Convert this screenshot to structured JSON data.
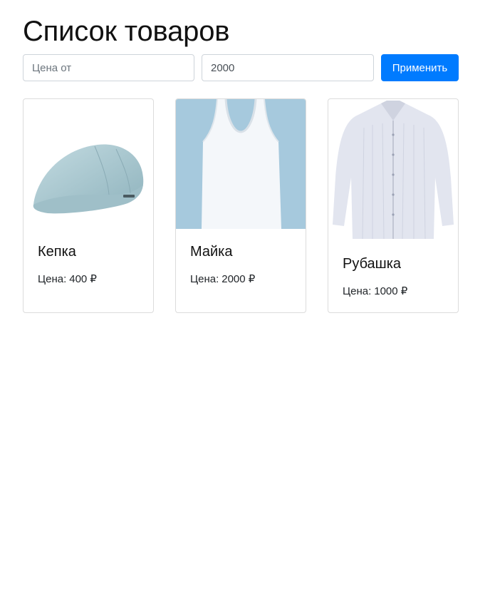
{
  "page": {
    "title": "Список товаров"
  },
  "filter": {
    "price_from": {
      "value": "",
      "placeholder": "Цена от"
    },
    "price_to": {
      "value": "2000",
      "placeholder": ""
    },
    "apply_label": "Применить"
  },
  "products": [
    {
      "name": "Кепка",
      "price_label": "Цена:",
      "price": "400 ₽",
      "icon": "flat-cap-image"
    },
    {
      "name": "Майка",
      "price_label": "Цена:",
      "price": "2000 ₽",
      "icon": "tank-top-image"
    },
    {
      "name": "Рубашка",
      "price_label": "Цена:",
      "price": "1000 ₽",
      "icon": "shirt-image"
    }
  ],
  "colors": {
    "primary": "#007bff",
    "cap": "#a9c9d1",
    "tank_background": "#a6c9dd",
    "shirt": "#dfe2ee"
  }
}
